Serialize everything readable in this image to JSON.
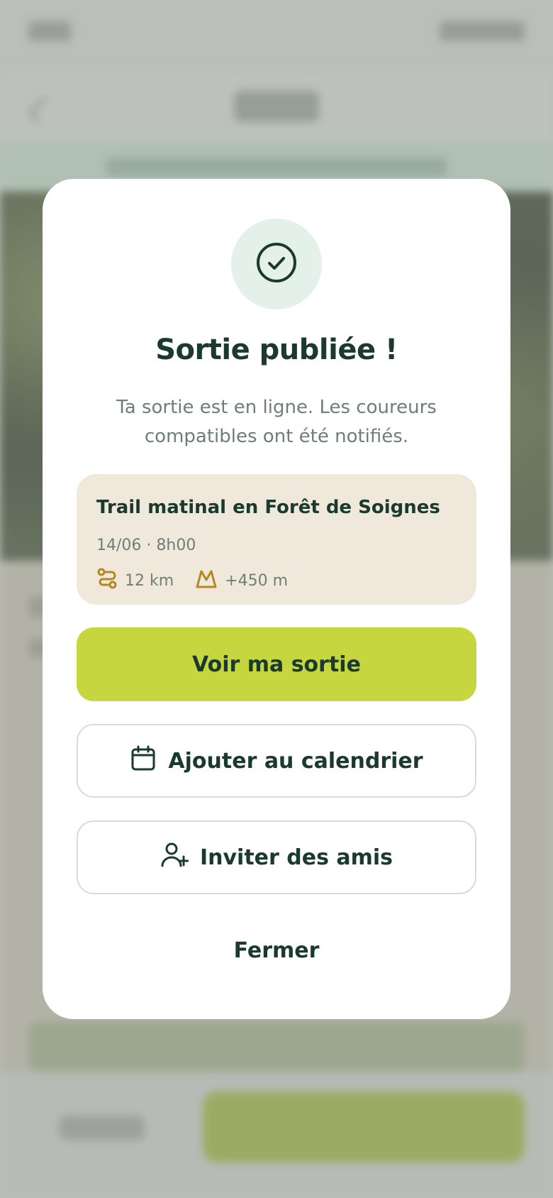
{
  "modal": {
    "title": "Sortie publiée !",
    "subtitle": "Ta sortie est en ligne. Les coureurs compatibles ont été notifiés.",
    "outing": {
      "title": "Trail matinal en Forêt de Soignes",
      "date": "14/06 · 8h00",
      "distance": "12 km",
      "elevation": "+450 m"
    },
    "buttons": {
      "view": "Voir ma sortie",
      "calendar": "Ajouter au calendrier",
      "invite": "Inviter des amis",
      "close": "Fermer"
    },
    "icons": {
      "success": "check-circle-icon",
      "distance": "route-icon",
      "elevation": "mountain-icon",
      "calendar": "calendar-icon",
      "invite": "user-plus-icon"
    }
  },
  "colors": {
    "primary": "#c5d63f",
    "text_dark": "#1b3a2e",
    "text_muted": "#6f7f77",
    "card_bg": "#efe8db",
    "success_bg": "#e3f1ea",
    "accent_gold": "#b3891f"
  }
}
